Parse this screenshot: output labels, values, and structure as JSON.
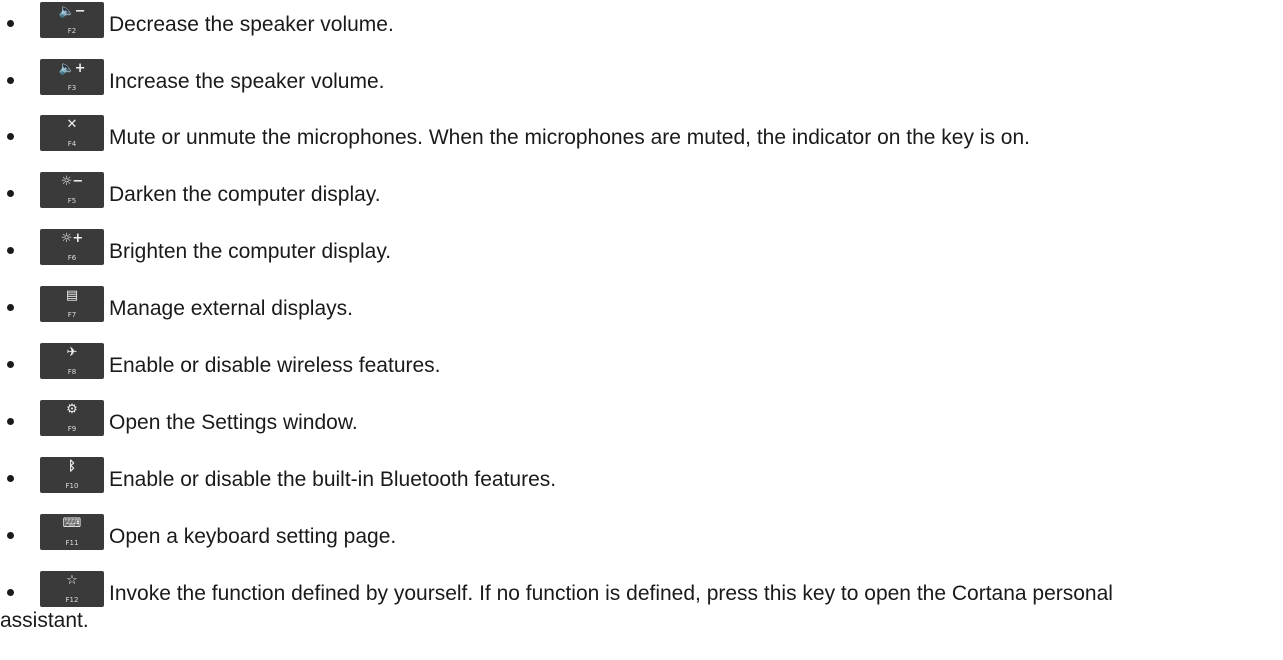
{
  "function_keys": [
    {
      "key": "F2",
      "icon": "volume-down-icon",
      "glyph": "🔈−",
      "description": "Decrease the speaker volume."
    },
    {
      "key": "F3",
      "icon": "volume-up-icon",
      "glyph": "🔈+",
      "description": "Increase the speaker volume."
    },
    {
      "key": "F4",
      "icon": "mic-mute-icon",
      "glyph": "✕",
      "description": "Mute or unmute the microphones. When the microphones are muted, the indicator on the key is on."
    },
    {
      "key": "F5",
      "icon": "brightness-down-icon",
      "glyph": "☼−",
      "description": "Darken the computer display."
    },
    {
      "key": "F6",
      "icon": "brightness-up-icon",
      "glyph": "☼+",
      "description": "Brighten the computer display."
    },
    {
      "key": "F7",
      "icon": "external-display-icon",
      "glyph": "▤",
      "description": "Manage external displays."
    },
    {
      "key": "F8",
      "icon": "wireless-off-icon",
      "glyph": "✈",
      "description": "Enable or disable wireless features."
    },
    {
      "key": "F9",
      "icon": "settings-gear-icon",
      "glyph": "⚙",
      "description": "Open the Settings window."
    },
    {
      "key": "F10",
      "icon": "bluetooth-icon",
      "glyph": "ᛒ",
      "description": "Enable or disable the built-in Bluetooth features."
    },
    {
      "key": "F11",
      "icon": "keyboard-icon",
      "glyph": "⌨",
      "description": "Open a keyboard setting page."
    },
    {
      "key": "F12",
      "icon": "star-icon",
      "glyph": "☆",
      "description": "Invoke the function defined by yourself. If no function is defined, press this key to open the Cortana personal assistant."
    }
  ]
}
